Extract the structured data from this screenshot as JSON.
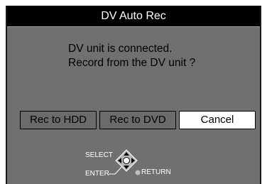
{
  "dialog": {
    "title": "DV Auto Rec",
    "message_line1": "DV unit is connected.",
    "message_line2": "Record from the DV unit ?"
  },
  "buttons": {
    "rec_hdd": "Rec to HDD",
    "rec_dvd": "Rec to DVD",
    "cancel": "Cancel"
  },
  "navigation": {
    "select": "SELECT",
    "enter": "ENTER",
    "return": "RETURN"
  },
  "colors": {
    "panel": "#707070",
    "title_bar": "#000000",
    "selected_button": "#ffffff"
  },
  "icons": [
    "dpad-icon",
    "return-dot-icon"
  ]
}
